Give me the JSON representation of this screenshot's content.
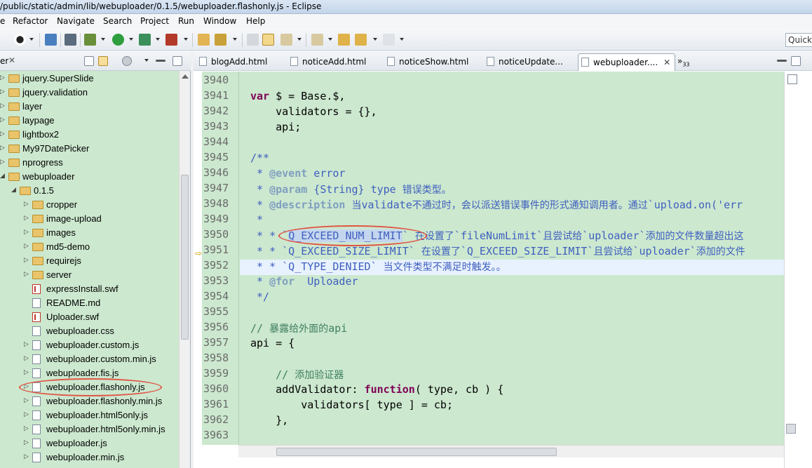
{
  "window": {
    "title": "/public/static/admin/lib/webuploader/0.1.5/webuploader.flashonly.js - Eclipse"
  },
  "menu": [
    "e",
    "Refactor",
    "Navigate",
    "Search",
    "Project",
    "Run",
    "Window",
    "Help"
  ],
  "toolbar": {
    "quick_access": "Quick"
  },
  "explorer": {
    "tab_label": "er",
    "items": [
      {
        "label": "jquery.SuperSlide",
        "type": "folder"
      },
      {
        "label": "jquery.validation",
        "type": "folder"
      },
      {
        "label": "layer",
        "type": "folder"
      },
      {
        "label": "laypage",
        "type": "folder"
      },
      {
        "label": "lightbox2",
        "type": "folder"
      },
      {
        "label": "My97DatePicker",
        "type": "folder"
      },
      {
        "label": "nprogress",
        "type": "folder"
      },
      {
        "label": "webuploader",
        "type": "folder"
      },
      {
        "label": "0.1.5",
        "type": "folder"
      },
      {
        "label": "cropper",
        "type": "folder"
      },
      {
        "label": "image-upload",
        "type": "folder"
      },
      {
        "label": "images",
        "type": "folder"
      },
      {
        "label": "md5-demo",
        "type": "folder"
      },
      {
        "label": "requirejs",
        "type": "folder"
      },
      {
        "label": "server",
        "type": "folder"
      },
      {
        "label": "expressInstall.swf",
        "type": "swf"
      },
      {
        "label": "README.md",
        "type": "file"
      },
      {
        "label": "Uploader.swf",
        "type": "swf"
      },
      {
        "label": "webuploader.css",
        "type": "file"
      },
      {
        "label": "webuploader.custom.js",
        "type": "js"
      },
      {
        "label": "webuploader.custom.min.js",
        "type": "js"
      },
      {
        "label": "webuploader.fis.js",
        "type": "js"
      },
      {
        "label": "webuploader.flashonly.js",
        "type": "js"
      },
      {
        "label": "webuploader.flashonly.min.js",
        "type": "js"
      },
      {
        "label": "webuploader.html5only.js",
        "type": "js"
      },
      {
        "label": "webuploader.html5only.min.js",
        "type": "js"
      },
      {
        "label": "webuploader.js",
        "type": "js"
      },
      {
        "label": "webuploader.min.js",
        "type": "js"
      }
    ]
  },
  "editor": {
    "tabs": [
      "blogAdd.html",
      "noticeAdd.html",
      "noticeShow.html",
      "noticeUpdate...",
      "webuploader...."
    ],
    "more_tabs": "»",
    "more_count": "33",
    "line_numbers": [
      "3940",
      "3941",
      "3942",
      "3943",
      "3944",
      "3945",
      "3946",
      "3947",
      "3948",
      "3949",
      "3950",
      "3951",
      "3952",
      "3953",
      "3954",
      "3955",
      "3956",
      "3957",
      "3958",
      "3959",
      "3960",
      "3961",
      "3962",
      "3963"
    ],
    "lines": {
      "l3941_kw": "var",
      "l3941_rest": " $ = Base.$,",
      "l3942": "    validators = {},",
      "l3943": "    api;",
      "l3945": "/**",
      "l3946_a": " * ",
      "l3946_tag": "@event",
      "l3946_b": " error",
      "l3947_a": " * ",
      "l3947_tag": "@param",
      "l3947_b": " {String} type ",
      "l3947_cjk": "错误类型。",
      "l3948_a": " * ",
      "l3948_tag": "@description",
      "l3948_b": " ",
      "l3948_cjk1": "当",
      "l3948_c": "validate",
      "l3948_cjk2": "不通过时，会以派送错误事件的形式通知调用者。通过",
      "l3948_d": "`upload.on('err",
      "l3949": " *",
      "l3950_a": " * * `",
      "l3950_sel": "Q_EXCEED_NUM_LIMIT",
      "l3950_b": "` ",
      "l3950_cjk1": "在设置了",
      "l3950_c": "`fileNumLimit`",
      "l3950_cjk2": "且尝试给",
      "l3950_d": "`uploader`",
      "l3950_cjk3": "添加的文件数量超出这",
      "l3951_a": " * * `Q_EXCEED_SIZE_LIMIT` ",
      "l3951_cjk1": "在设置了",
      "l3951_b": "`Q_EXCEED_SIZE_LIMIT`",
      "l3951_cjk2": "且尝试给",
      "l3951_c": "`uploader`",
      "l3951_cjk3": "添加的文件",
      "l3952_a": " * * `Q_TYPE_DENIED` ",
      "l3952_cjk": "当文件类型不满足时触发。。",
      "l3953_a": " * ",
      "l3953_tag": "@for",
      "l3953_b": "  Uploader",
      "l3954": " */",
      "l3956_a": "// ",
      "l3956_cjk": "暴露给外面的",
      "l3956_b": "api",
      "l3957": "api = {",
      "l3959_a": "    // ",
      "l3959_cjk": "添加验证器",
      "l3960_a": "    addValidator: ",
      "l3960_kw": "function",
      "l3960_b": "( type, cb ) {",
      "l3961": "        validators[ type ] = cb;",
      "l3962": "    },"
    }
  }
}
